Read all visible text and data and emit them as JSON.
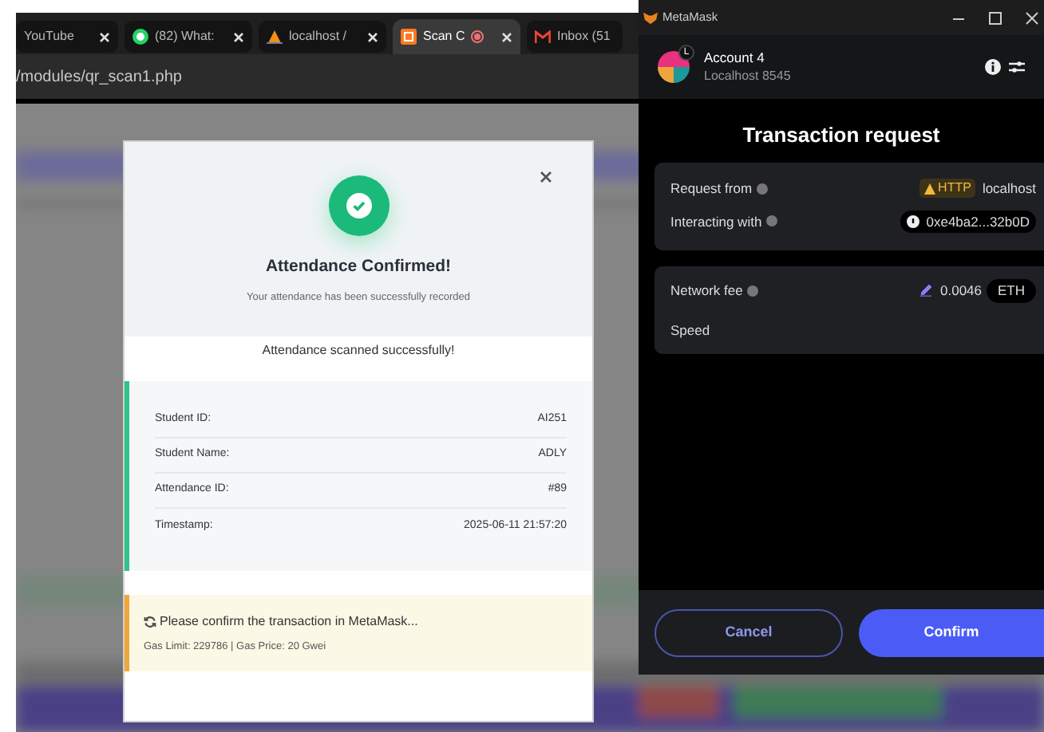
{
  "browser": {
    "tabs": [
      {
        "title": "YouTube",
        "selected": false
      },
      {
        "title": "(82) What:",
        "selected": false
      },
      {
        "title": "localhost /",
        "selected": false
      },
      {
        "title": "Scan C",
        "selected": true
      },
      {
        "title": "Inbox (51",
        "selected": false
      }
    ],
    "address": "/modules/qr_scan1.php"
  },
  "modal": {
    "title": "Attendance Confirmed!",
    "subtitle": "Your attendance has been successfully recorded",
    "message": "Attendance scanned successfully!",
    "details": [
      {
        "label": "Student ID:",
        "value": "AI251"
      },
      {
        "label": "Student Name:",
        "value": "ADLY"
      },
      {
        "label": "Attendance ID:",
        "value": "#89"
      },
      {
        "label": "Timestamp:",
        "value": "2025-06-11 21:57:20"
      }
    ],
    "notice": {
      "text": "Please confirm the transaction in MetaMask...",
      "detail": "Gas Limit: 229786 | Gas Price: 20 Gwei"
    }
  },
  "metamask": {
    "window_title": "MetaMask",
    "account": "Account 4",
    "network": "Localhost 8545",
    "avatar_badge": "L",
    "heading": "Transaction request",
    "request_from": {
      "label": "Request from",
      "badge": "HTTP",
      "value": "localhost"
    },
    "interacting_with": {
      "label": "Interacting with",
      "value": "0xe4ba2...32b0D"
    },
    "network_fee": {
      "label": "Network fee",
      "value": "0.0046",
      "unit": "ETH"
    },
    "speed": {
      "label": "Speed"
    },
    "buttons": [
      {
        "label": "Cancel",
        "kind": "secondary"
      },
      {
        "label": "Confirm",
        "kind": "primary"
      }
    ]
  }
}
